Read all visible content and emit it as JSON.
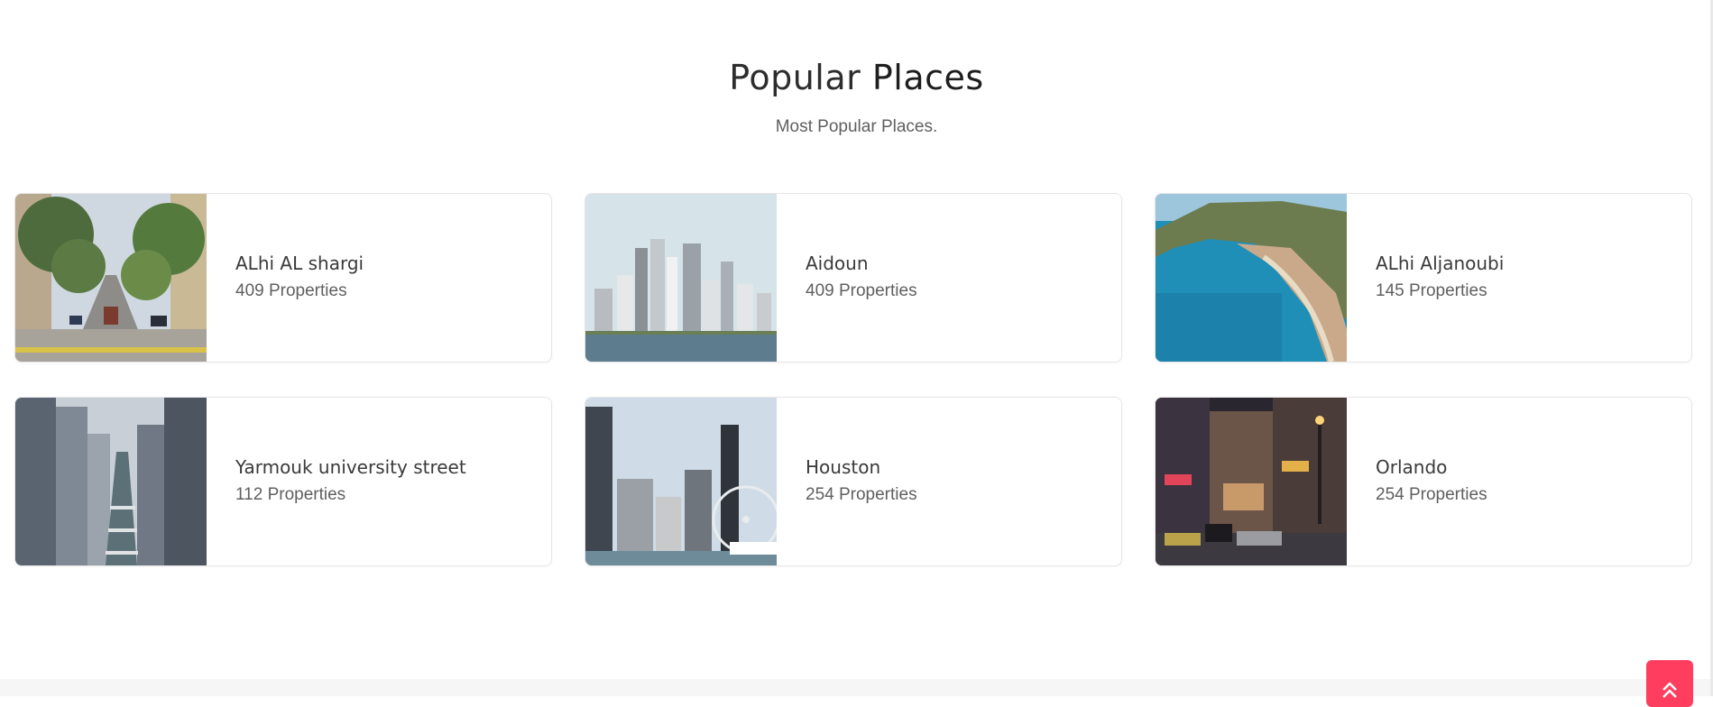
{
  "section": {
    "title_part1": "Popular",
    "title_part2": "Places",
    "subtitle": "Most Popular Places."
  },
  "places": [
    {
      "name": "ALhi AL shargi",
      "count": "409 Properties",
      "image": "street-trees-image"
    },
    {
      "name": "Aidoun",
      "count": "409 Properties",
      "image": "skyline-water-image"
    },
    {
      "name": "ALhi Aljanoubi",
      "count": "145 Properties",
      "image": "coastal-bay-image"
    },
    {
      "name": "Yarmouk university street",
      "count": "112 Properties",
      "image": "city-canyon-image"
    },
    {
      "name": "Houston",
      "count": "254 Properties",
      "image": "ferris-wheel-skyline-image"
    },
    {
      "name": "Orlando",
      "count": "254 Properties",
      "image": "night-street-image"
    }
  ],
  "scroll_top": {
    "icon": "double-chevron-up-icon",
    "color": "#ff3d5f"
  }
}
